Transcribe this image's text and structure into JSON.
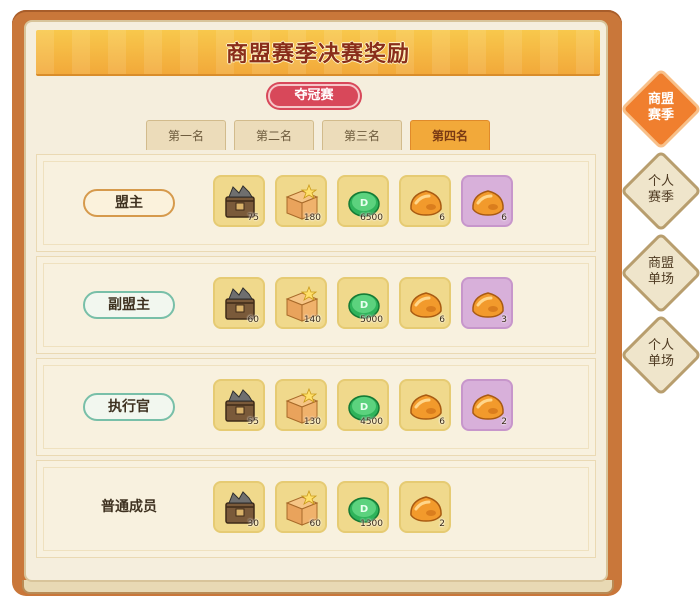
{
  "header": {
    "title": "商盟赛季决赛奖励",
    "subtitle": "夺冠赛"
  },
  "tabs": [
    {
      "label": "第一名",
      "active": false
    },
    {
      "label": "第二名",
      "active": false
    },
    {
      "label": "第三名",
      "active": false
    },
    {
      "label": "第四名",
      "active": true
    }
  ],
  "rows": [
    {
      "role": "盟主",
      "role_style": "gold",
      "rewards": [
        {
          "icon": "crate-icon",
          "qty": "75"
        },
        {
          "icon": "box-icon",
          "qty": "180"
        },
        {
          "icon": "jade-coin-icon",
          "qty": "6500"
        },
        {
          "icon": "amber-stone-icon",
          "qty": "6"
        },
        {
          "icon": "amber-stone-icon",
          "qty": "6",
          "rare": true
        }
      ]
    },
    {
      "role": "副盟主",
      "role_style": "teal",
      "rewards": [
        {
          "icon": "crate-icon",
          "qty": "60"
        },
        {
          "icon": "box-icon",
          "qty": "140"
        },
        {
          "icon": "jade-coin-icon",
          "qty": "5000"
        },
        {
          "icon": "amber-stone-icon",
          "qty": "6"
        },
        {
          "icon": "amber-stone-icon",
          "qty": "3",
          "rare": true
        }
      ]
    },
    {
      "role": "执行官",
      "role_style": "teal",
      "rewards": [
        {
          "icon": "crate-icon",
          "qty": "55"
        },
        {
          "icon": "box-icon",
          "qty": "130"
        },
        {
          "icon": "jade-coin-icon",
          "qty": "4500"
        },
        {
          "icon": "amber-stone-icon",
          "qty": "6"
        },
        {
          "icon": "amber-stone-icon",
          "qty": "2",
          "rare": true
        }
      ]
    },
    {
      "role": "普通成员",
      "role_style": "plain",
      "rewards": [
        {
          "icon": "crate-icon",
          "qty": "30"
        },
        {
          "icon": "box-icon",
          "qty": "60"
        },
        {
          "icon": "jade-coin-icon",
          "qty": "1300"
        },
        {
          "icon": "amber-stone-icon",
          "qty": "2"
        }
      ]
    }
  ],
  "side_tabs": [
    {
      "line1": "商盟",
      "line2": "赛季",
      "active": true
    },
    {
      "line1": "个人",
      "line2": "赛季",
      "active": false
    },
    {
      "line1": "商盟",
      "line2": "单场",
      "active": false
    },
    {
      "line1": "个人",
      "line2": "单场",
      "active": false
    }
  ],
  "colors": {
    "frame": "#c9773a",
    "banner": "#f2a93a",
    "title": "#8a2d1a",
    "accent_tab": "#f07f2e",
    "rare_slot": "#d8b0da"
  }
}
